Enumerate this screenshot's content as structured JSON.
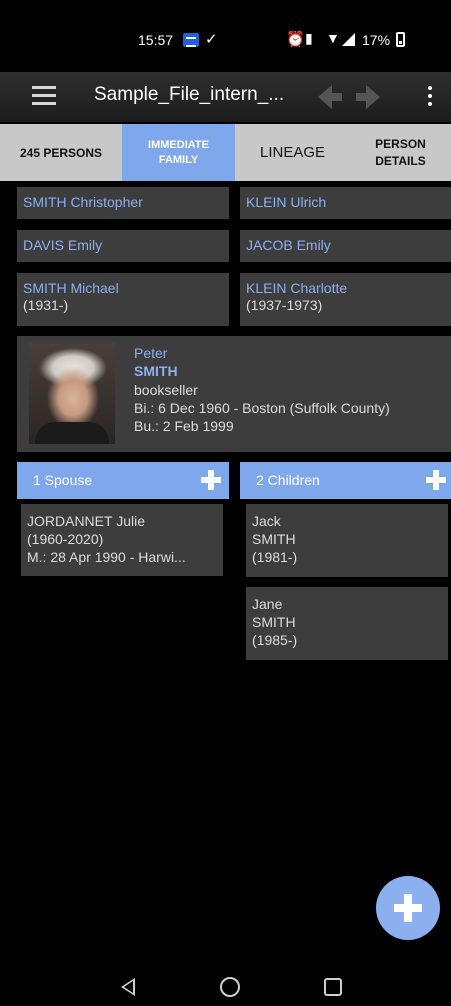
{
  "status_bar": {
    "time": "15:57",
    "check_glyph": "✓",
    "alarm_glyph": "⏰",
    "vibrate_glyph": "▮",
    "wifi_glyph": "▼",
    "battery_text": "17%"
  },
  "toolbar": {
    "title": "Sample_File_intern_..."
  },
  "tabs": [
    {
      "label": "245 PERSONS",
      "active": false
    },
    {
      "label": "IMMEDIATE FAMILY",
      "active": true
    },
    {
      "label": "LINEAGE",
      "active": false
    },
    {
      "label": "PERSON DETAILS",
      "active": false
    }
  ],
  "ancestors": {
    "paternal_grandfather": "SMITH Christopher",
    "maternal_grandfather": "KLEIN Ulrich",
    "paternal_grandmother": "DAVIS Emily",
    "maternal_grandmother": "JACOB Emily",
    "father_name": "SMITH Michael",
    "father_dates": "(1931-)",
    "mother_name": "KLEIN Charlotte",
    "mother_dates": "(1937-1973)"
  },
  "person": {
    "first_name": "Peter",
    "last_name": "SMITH",
    "occupation": "bookseller",
    "birth": "Bi.: 6 Dec 1960 - Boston (Suffolk County)",
    "burial": "Bu.: 2 Feb 1999"
  },
  "spouses": {
    "header": "1 Spouse",
    "items": [
      {
        "name": "JORDANNET Julie",
        "dates": "(1960-2020)",
        "marriage": "M.: 28 Apr 1990 - Harwi..."
      }
    ]
  },
  "children": {
    "header": "2 Children",
    "items": [
      {
        "first": "Jack",
        "last": "SMITH",
        "dates": "(1981-)"
      },
      {
        "first": "Jane",
        "last": "SMITH",
        "dates": "(1985-)"
      }
    ]
  },
  "colors": {
    "accent": "#7fa8ec",
    "link_text": "#8cb0ef",
    "card_bg": "#3d3d3d",
    "tab_bar_bg": "#c8c8c8"
  }
}
